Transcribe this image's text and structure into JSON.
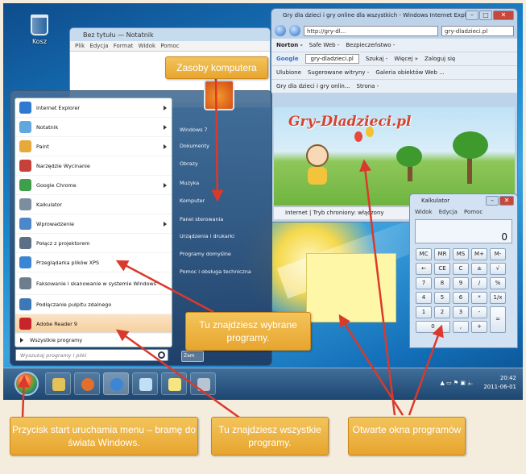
{
  "desktop": {
    "recycle_label": "Kosz"
  },
  "notepad": {
    "title": "Bez tytułu — Notatnik",
    "menu": "Plik  Edycja  Format  Widok  Pomoc"
  },
  "ie": {
    "title": "Gry dla dzieci i gry online dla wszystkich - Windows Internet Explo...",
    "address": "http://gry-dl... ",
    "tab_search": "gry-dladzieci.pl",
    "norton": "Norton -",
    "safe_web": "Safe Web -",
    "identity": "Bezpieczeństwo -",
    "google_label": "Google",
    "google_query": "gry-dladzieci.pl",
    "search_btn": "Szukaj -",
    "more": "Więcej »",
    "login": "Zaloguj się",
    "favorites": "Ulubione",
    "suggested": "Sugerowane witryny -",
    "gallery": "Galeria obiektów Web ...",
    "tab": "Gry dla dzieci i gry onlin...",
    "page_menu": "Strona -",
    "site_logo": "Gry-Dladzieci.pl",
    "status": "Internet | Tryb chroniony: włączony"
  },
  "calculator": {
    "title": "Kalkulator",
    "menu": "Widok  Edycja  Pomoc",
    "display": "0",
    "keys": [
      "MC",
      "MR",
      "MS",
      "M+",
      "M-",
      "←",
      "CE",
      "C",
      "±",
      "√",
      "7",
      "8",
      "9",
      "/",
      "%",
      "4",
      "5",
      "6",
      "*",
      "1/x",
      "1",
      "2",
      "3",
      "-",
      "=",
      "0",
      ",",
      "+"
    ]
  },
  "start_menu": {
    "programs": [
      {
        "label": "Internet Explorer",
        "arrow": true,
        "color": "#2f79d0"
      },
      {
        "label": "Notatnik",
        "arrow": true,
        "color": "#5fa7de"
      },
      {
        "label": "Paint",
        "arrow": true,
        "color": "#e6a93c"
      },
      {
        "label": "Narzędzie Wycinanie",
        "arrow": false,
        "color": "#c6413a"
      },
      {
        "label": "Google Chrome",
        "arrow": true,
        "color": "#3ea04a"
      },
      {
        "label": "Kalkulator",
        "arrow": false,
        "color": "#7c8da0"
      },
      {
        "label": "Wprowadzenie",
        "arrow": true,
        "color": "#4b87c9"
      },
      {
        "label": "Połącz z projektorem",
        "arrow": false,
        "color": "#5c6f86"
      },
      {
        "label": "Przeglądarka plików XPS",
        "arrow": false,
        "color": "#3a86d4"
      },
      {
        "label": "Faksowanie i skanowanie w systemie Windows",
        "arrow": false,
        "color": "#6d7d8d"
      },
      {
        "label": "Podłączanie pulpitu zdalnego",
        "arrow": false,
        "color": "#3c78b8"
      },
      {
        "label": "Adobe Reader 9",
        "arrow": false,
        "color": "#c8252b"
      }
    ],
    "all_programs": "Wszystkie programy",
    "search_placeholder": "Wyszukaj programy i pliki",
    "right_links": [
      "Windows 7",
      "Dokumenty",
      "Obrazy",
      "Muzyka",
      "Komputer",
      "Panel sterowania",
      "Urządzenia i drukarki",
      "Programy domyślne",
      "Pomoc i obsługa techniczna"
    ],
    "shutdown": "Zam"
  },
  "taskbar": {
    "time": "20:42",
    "date": "2011-06-01"
  },
  "callouts": {
    "resources": "Zasoby komputera",
    "chosen": "Tu znajdziesz wybrane programy.",
    "start": "Przycisk start uruchamia menu – bramę do świata Windows.",
    "all": "Tu znajdziesz wszystkie programy.",
    "open": "Otwarte okna programów"
  }
}
